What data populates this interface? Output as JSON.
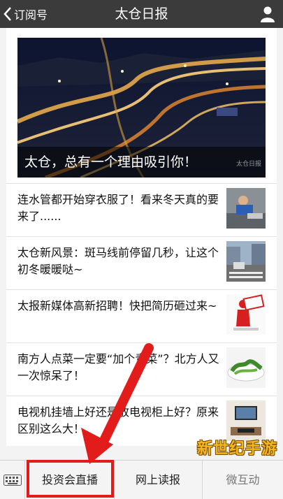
{
  "header": {
    "back_label": "订阅号",
    "title": "太仓日报"
  },
  "hero": {
    "caption": "太仓，总有一个理由吸引你！",
    "watermark": "太仓日报"
  },
  "articles": [
    {
      "title": "连水管都开始穿衣服了！看来冬天真的要来了......"
    },
    {
      "title": "太仓新风景：斑马线前停留几秒，让这个初冬暖暖哒~"
    },
    {
      "title": "太报新媒体高新招聘！快把简历砸过来~"
    },
    {
      "title": "南方人点菜一定要“加个青菜”？北方人又一次惊呆了！"
    },
    {
      "title": "电视机挂墙上好还是放电视柜上好？原来区别这么大！"
    }
  ],
  "menu": {
    "items": [
      "投资会直播",
      "网上读报",
      "微互动"
    ]
  },
  "overlay": {
    "brand": "新世纪手游",
    "highlight_color": "#e21b1b"
  }
}
